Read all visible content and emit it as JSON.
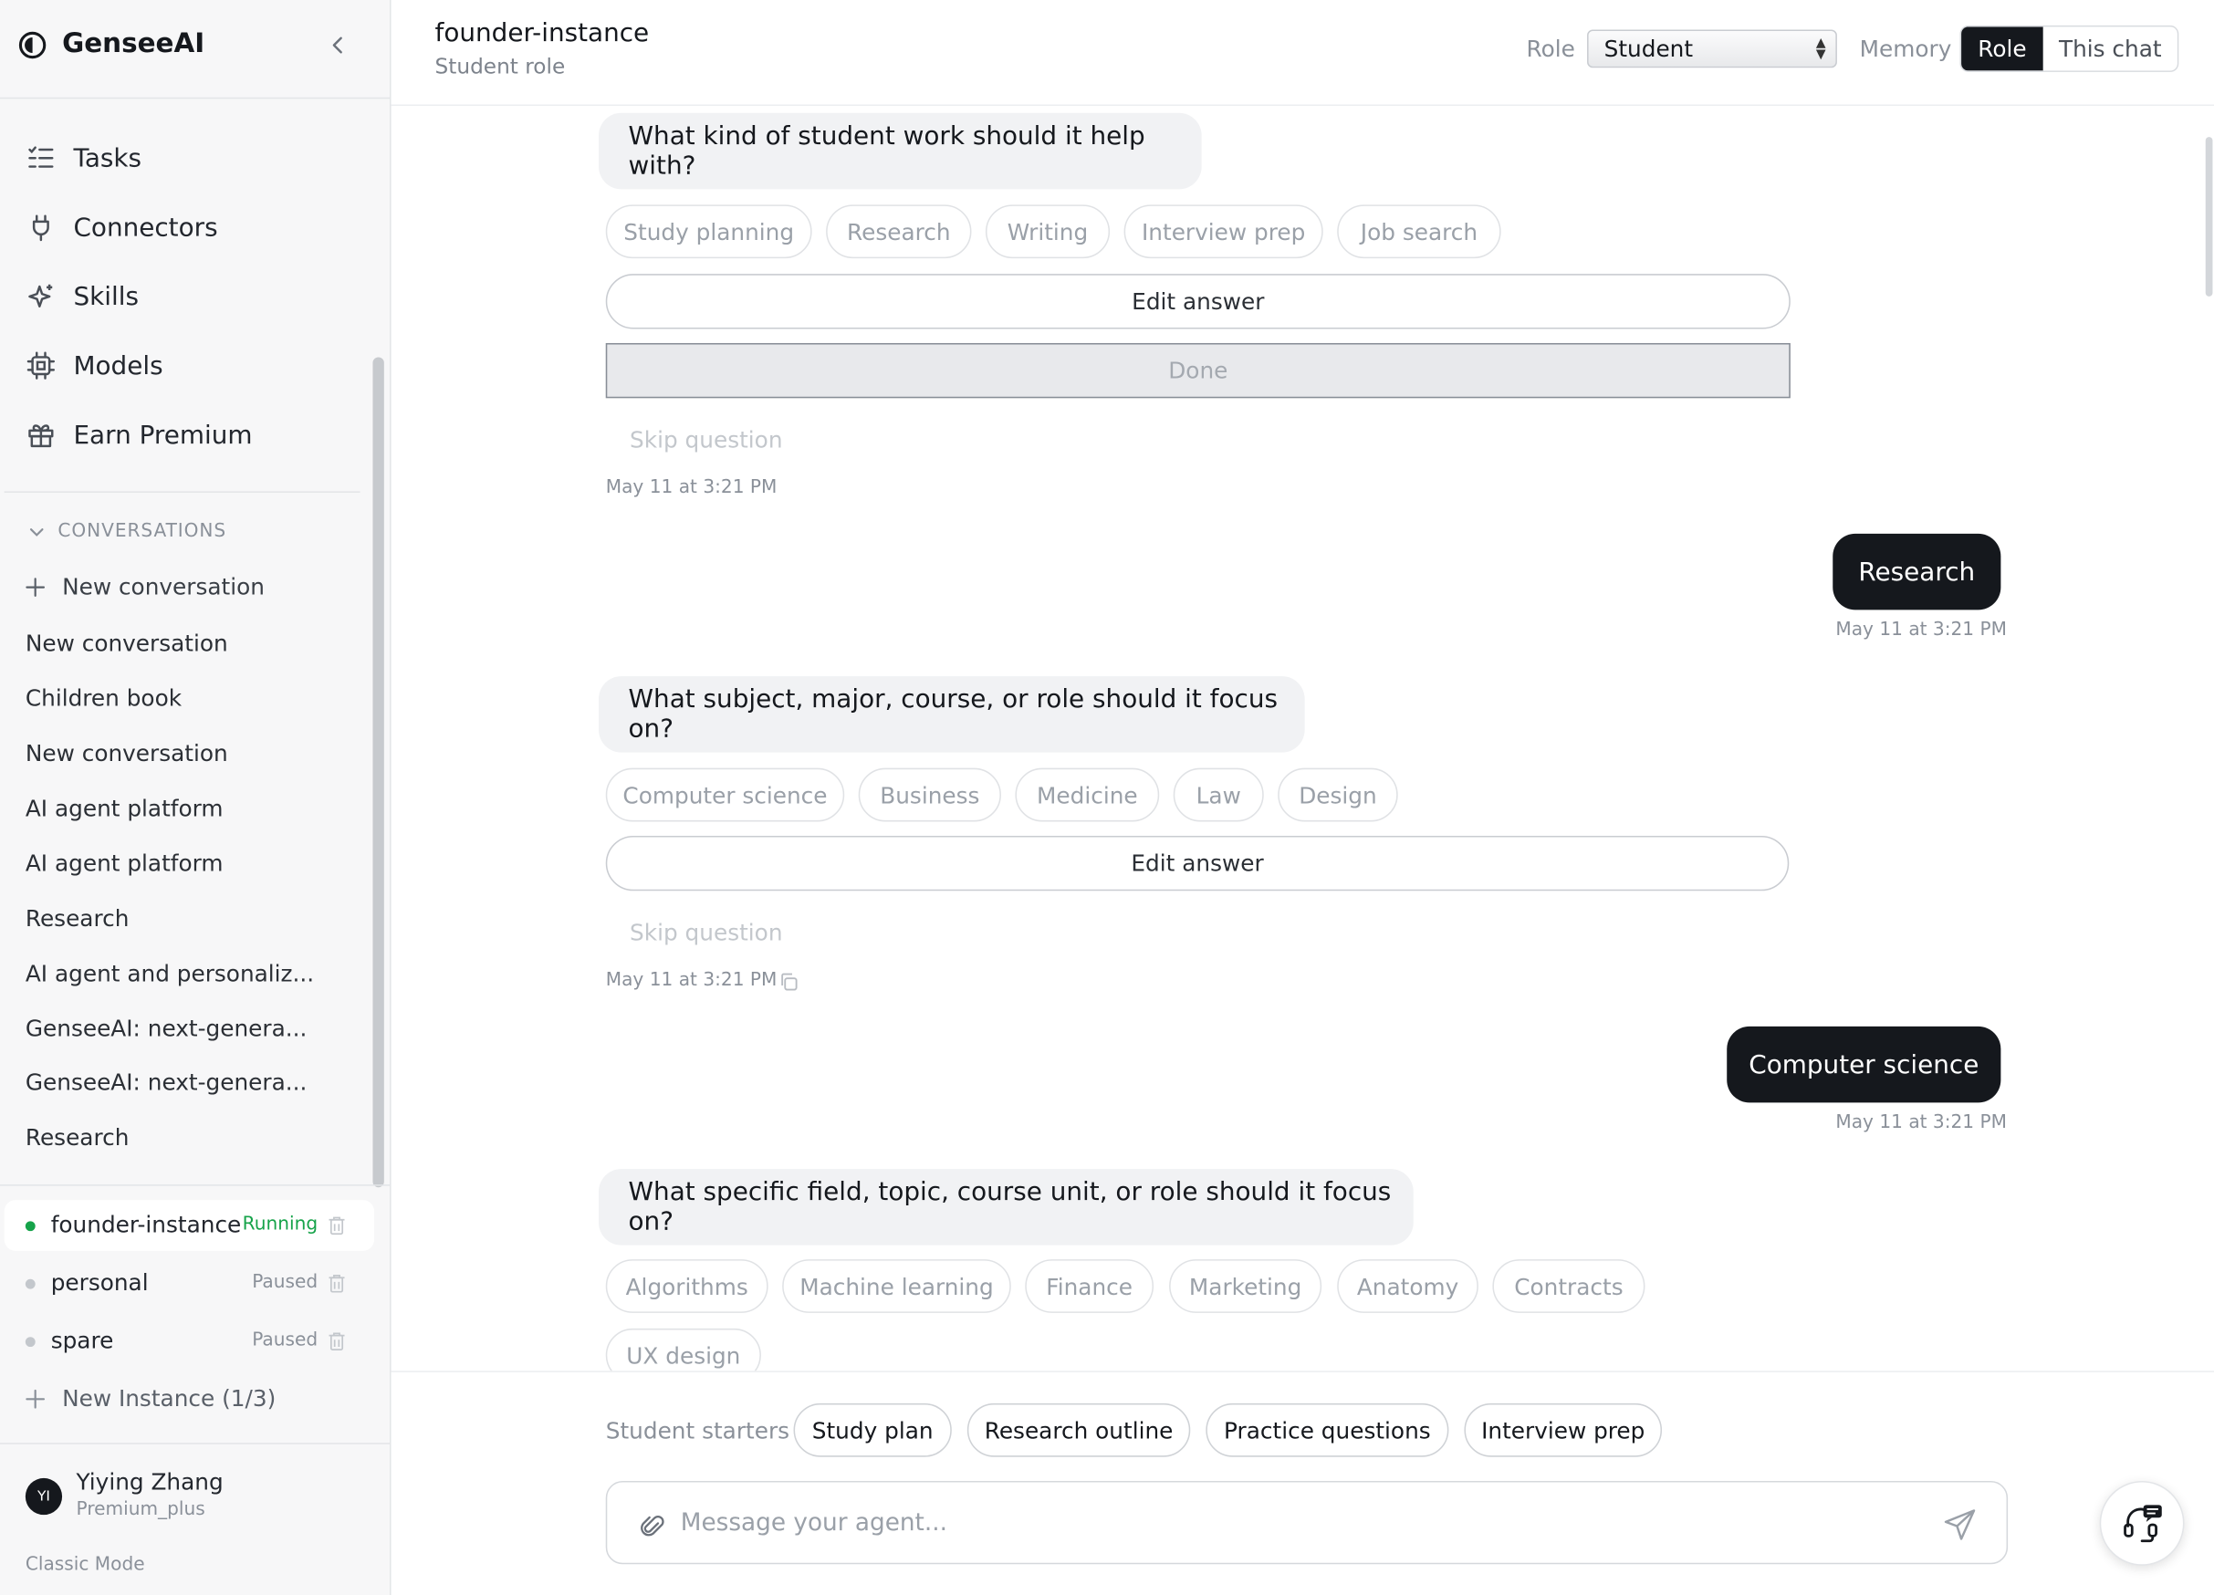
{
  "app": {
    "name": "GenseeAI"
  },
  "nav": {
    "items": [
      {
        "label": "Tasks",
        "icon": "tasks-icon"
      },
      {
        "label": "Connectors",
        "icon": "plug-icon"
      },
      {
        "label": "Skills",
        "icon": "sparkle-icon"
      },
      {
        "label": "Models",
        "icon": "chip-icon"
      },
      {
        "label": "Earn Premium",
        "icon": "gift-icon"
      }
    ]
  },
  "conversations": {
    "header": "CONVERSATIONS",
    "new_label": "New conversation",
    "items": [
      "New conversation",
      "Children book",
      "New conversation",
      "AI agent platform",
      "AI agent platform",
      "Research",
      "AI agent and personaliz...",
      "GenseeAI: next-genera...",
      "GenseeAI: next-genera...",
      "Research"
    ]
  },
  "instances": {
    "items": [
      {
        "name": "founder-instance",
        "status": "Running",
        "status_color": "#16a34a",
        "dot_color": "#16a34a"
      },
      {
        "name": "personal",
        "status": "Paused",
        "status_color": "#8a9099",
        "dot_color": "#c3c7cc"
      },
      {
        "name": "spare",
        "status": "Paused",
        "status_color": "#8a9099",
        "dot_color": "#c3c7cc"
      }
    ],
    "new_label": "New Instance (1/3)"
  },
  "user": {
    "initials": "YI",
    "name": "Yiying Zhang",
    "plan": "Premium_plus",
    "mode": "Classic Mode"
  },
  "header": {
    "title": "founder-instance",
    "subtitle": "Student role",
    "role_label": "Role",
    "role_value": "Student",
    "memory_label": "Memory",
    "memory_options": [
      "Role",
      "This chat"
    ],
    "memory_selected": "Role"
  },
  "chat": {
    "questions": [
      {
        "text": "What kind of student work should it help with?",
        "options": [
          "Study planning",
          "Research",
          "Writing",
          "Interview prep",
          "Job search"
        ],
        "edit_label": "Edit answer",
        "done_label": "Done",
        "skip_label": "Skip question",
        "timestamp": "May 11 at 3:21 PM"
      },
      {
        "text": "What subject, major, course, or role should it focus on?",
        "options": [
          "Computer science",
          "Business",
          "Medicine",
          "Law",
          "Design"
        ],
        "edit_label": "Edit answer",
        "skip_label": "Skip question",
        "timestamp": "May 11 at 3:21 PM"
      },
      {
        "text": "What specific field, topic, course unit, or role should it focus on?",
        "options": [
          "Algorithms",
          "Machine learning",
          "Finance",
          "Marketing",
          "Anatomy",
          "Contracts",
          "UX design"
        ]
      }
    ],
    "answers": [
      {
        "text": "Research",
        "timestamp": "May 11 at 3:21 PM"
      },
      {
        "text": "Computer science",
        "timestamp": "May 11 at 3:21 PM"
      }
    ]
  },
  "composer": {
    "starters_label": "Student starters",
    "starters": [
      "Study plan",
      "Research outline",
      "Practice questions",
      "Interview prep"
    ],
    "placeholder": "Message your agent..."
  },
  "colors": {
    "accent_dark": "#15181d",
    "running": "#16a34a",
    "sidebar_bg": "#f7f7f8"
  }
}
